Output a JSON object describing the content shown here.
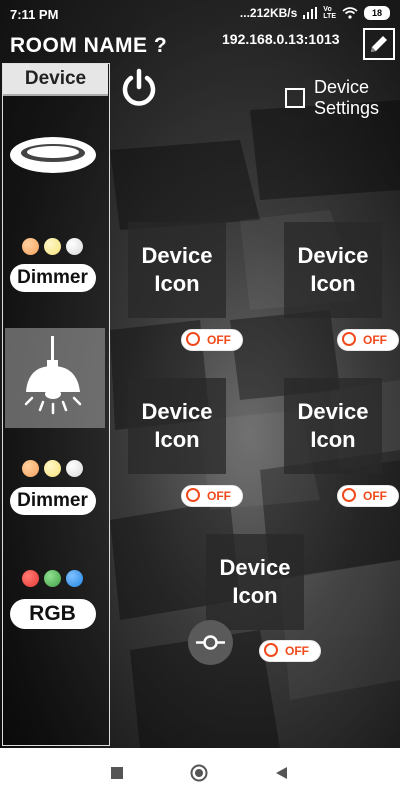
{
  "status_bar": {
    "time": "7:11 PM",
    "network_speed": "...212KB/s",
    "battery": "18"
  },
  "header": {
    "room_title": "ROOM NAME ?",
    "ip_address": "192.168.0.13:1013",
    "edit_icon": "pencil-icon"
  },
  "sidebar": {
    "title": "Device",
    "items": [
      {
        "icon": "ceiling-light-icon"
      },
      {
        "icon": "dimmer-dots-icon",
        "label": "Dimmer",
        "dot_colors": [
          "#f5a25d",
          "#f6e27a",
          "#e9e9e9"
        ]
      },
      {
        "icon": "pendant-lamp-icon",
        "selected": true
      },
      {
        "icon": "dimmer-dots-icon",
        "label": "Dimmer",
        "dot_colors": [
          "#f5a25d",
          "#f6e27a",
          "#e9e9e9"
        ]
      },
      {
        "icon": "rgb-dots-icon",
        "label": "RGB",
        "dot_colors": [
          "#e53935",
          "#43a047",
          "#1e88e5"
        ]
      }
    ]
  },
  "main": {
    "power_icon": "power-icon",
    "device_settings_label": "Device Settings",
    "device_settings_checked": false,
    "devices": [
      {
        "icon_label": "Device Icon",
        "toggle": "OFF"
      },
      {
        "icon_label": "Device Icon",
        "toggle": "OFF"
      },
      {
        "icon_label": "Device Icon",
        "toggle": "OFF"
      },
      {
        "icon_label": "Device Icon",
        "toggle": "OFF"
      },
      {
        "icon_label": "Device Icon",
        "toggle": "OFF"
      }
    ],
    "slider_icon": "slider-icon"
  },
  "colors": {
    "toggle_off": "#f04a1c",
    "sidebar_header_bg": "#e6e6e6"
  },
  "navbar": {
    "buttons": [
      "recent-apps-icon",
      "home-icon",
      "back-icon"
    ]
  }
}
